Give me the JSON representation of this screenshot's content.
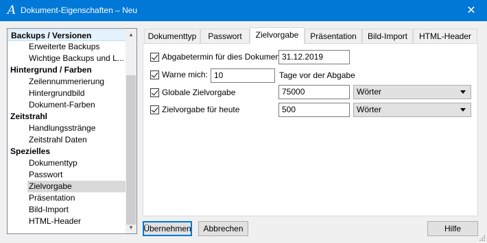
{
  "window": {
    "title": "Dokument-Eigenschaften – Neu",
    "app_icon": "A",
    "close_glyph": "✕"
  },
  "tree": {
    "items": [
      {
        "label": "Backups / Versionen",
        "type": "category"
      },
      {
        "label": "Erweiterte Backups",
        "type": "item"
      },
      {
        "label": "Wichtige Backups und L...",
        "type": "item"
      },
      {
        "label": "Hintergrund / Farben",
        "type": "category"
      },
      {
        "label": "Zeilennummerierung",
        "type": "item"
      },
      {
        "label": "Hintergrundbild",
        "type": "item"
      },
      {
        "label": "Dokument-Farben",
        "type": "item"
      },
      {
        "label": "Zeitstrahl",
        "type": "category"
      },
      {
        "label": "Handlungsstränge",
        "type": "item"
      },
      {
        "label": "Zeitstrahl Daten",
        "type": "item"
      },
      {
        "label": "Spezielles",
        "type": "category"
      },
      {
        "label": "Dokumenttyp",
        "type": "item"
      },
      {
        "label": "Passwort",
        "type": "item"
      },
      {
        "label": "Zielvorgabe",
        "type": "item",
        "selected": true
      },
      {
        "label": "Präsentation",
        "type": "item"
      },
      {
        "label": "Bild-Import",
        "type": "item"
      },
      {
        "label": "HTML-Header",
        "type": "item"
      }
    ]
  },
  "tabs": [
    "Dokumenttyp",
    "Passwort",
    "Zielvorgabe",
    "Präsentation",
    "Bild-Import",
    "HTML-Header"
  ],
  "active_tab": "Zielvorgabe",
  "form": {
    "deadline": {
      "label": "Abgabetermin für dies Dokument",
      "value": "31.12.2019",
      "checked": true
    },
    "warn": {
      "label": "Warne mich:",
      "value": "10",
      "suffix": "Tage vor der Abgabe",
      "checked": true
    },
    "global": {
      "label": "Globale Zielvorgabe",
      "value": "75000",
      "unit": "Wörter",
      "checked": true
    },
    "today": {
      "label": "Zielvorgabe für heute",
      "value": "500",
      "unit": "Wörter",
      "checked": true
    }
  },
  "buttons": {
    "apply": "Übernehmen",
    "cancel": "Abbrechen",
    "help": "Hilfe"
  },
  "colors": {
    "titlebar": "#0078d7",
    "selection": "#d9d9d9"
  }
}
